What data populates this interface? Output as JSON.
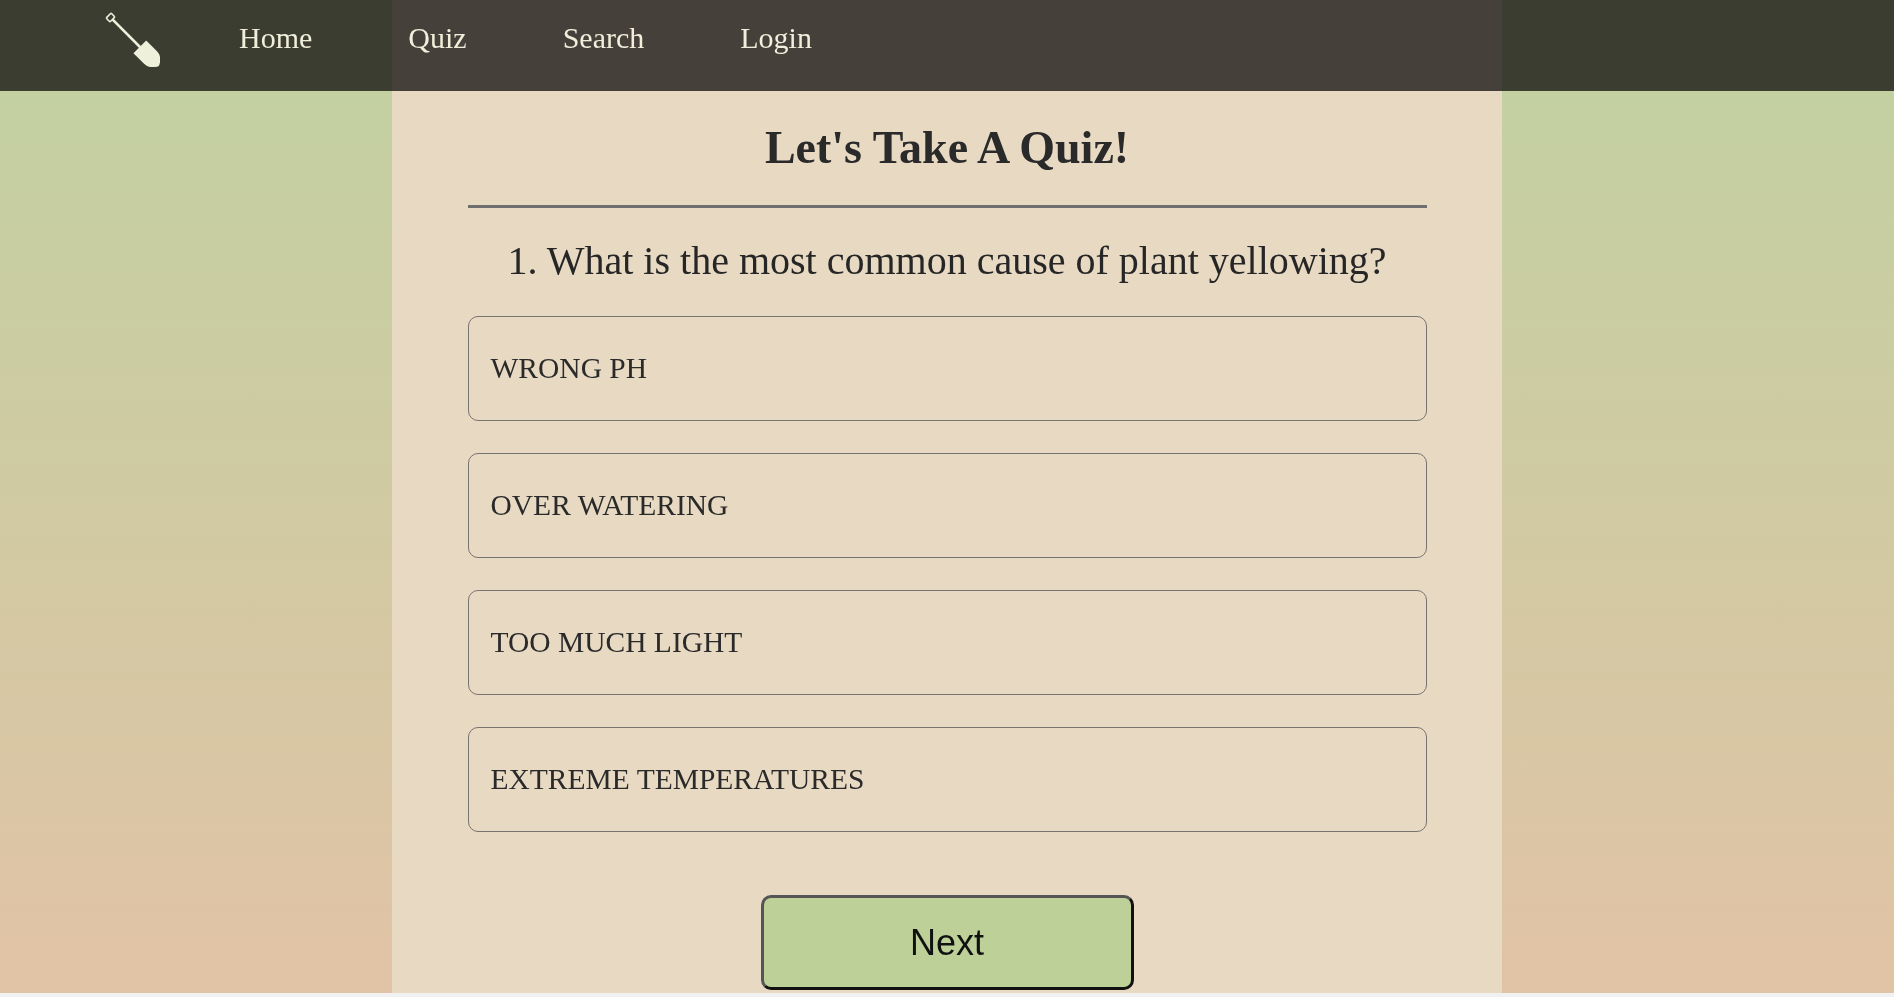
{
  "nav": {
    "items": [
      "Home",
      "Quiz",
      "Search",
      "Login"
    ]
  },
  "quiz": {
    "title": "Let's Take A Quiz!",
    "question": "1. What is the most common cause of plant yellowing?",
    "options": [
      {
        "label": "WRONG PH",
        "selected": false
      },
      {
        "label": "OVER WATERING",
        "selected": false
      },
      {
        "label": "TOO MUCH LIGHT",
        "selected": false
      },
      {
        "label": "EXTREME TEMPERATURES",
        "selected": false
      }
    ],
    "next_button": "Next"
  }
}
